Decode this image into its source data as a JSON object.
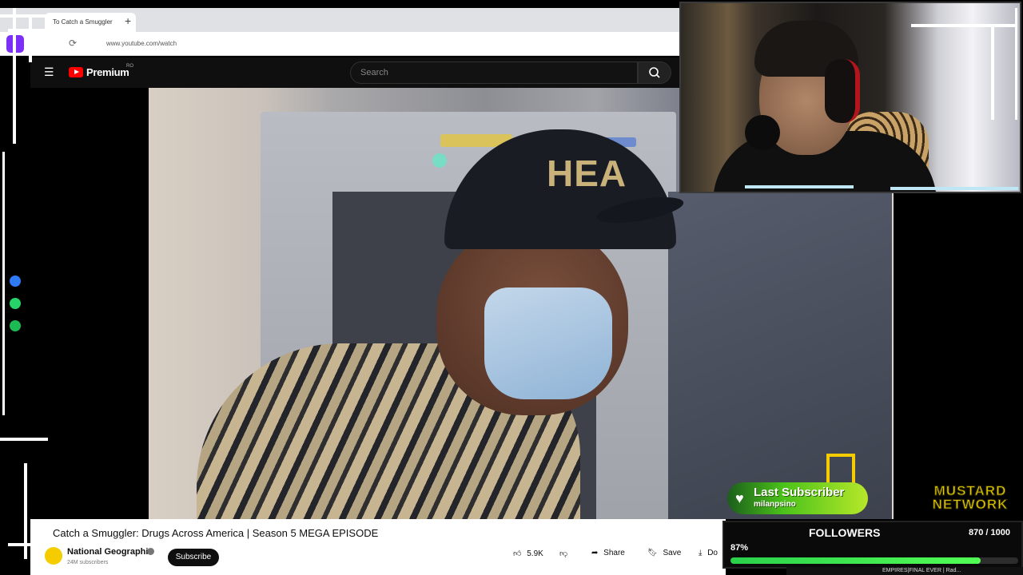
{
  "browser": {
    "tab_title": "To Catch a Smuggler",
    "new_tab_symbol": "+",
    "url": "www.youtube.com/watch"
  },
  "youtube": {
    "brand": "Premium",
    "country_code": "RO",
    "search_placeholder": "Search"
  },
  "video": {
    "cap_text": "HEA",
    "title": "Catch a Smuggler: Drugs Across America | Season 5 MEGA EPISODE",
    "channel": "National Geographic",
    "subscribers": "24M subscribers",
    "subscribe_label": "Subscribe",
    "likes": "5.9K",
    "share_label": "Share",
    "save_label": "Save",
    "download_label": "Do"
  },
  "sidebar_icons": [
    {
      "name": "messenger-icon",
      "color": "#2f7bf6"
    },
    {
      "name": "whatsapp-icon",
      "color": "#25d366"
    },
    {
      "name": "spotify-icon",
      "color": "#1db954"
    }
  ],
  "overlay": {
    "last_subscriber_title": "Last Subscriber",
    "last_subscriber_name": "milanpsino",
    "brand_line1": "MUSTARD",
    "brand_line2": "NETWORK",
    "followers_title": "FOLLOWERS",
    "followers_count": "870 / 1000",
    "followers_percent": "87%",
    "followers_progress": 0.87,
    "bottom_ticker": "EMPIRES|FINAL EVER | Rad..."
  },
  "colors": {
    "youtube_red": "#ff0000",
    "accent_green": "#52ff55",
    "mustard": "#e8d000"
  }
}
